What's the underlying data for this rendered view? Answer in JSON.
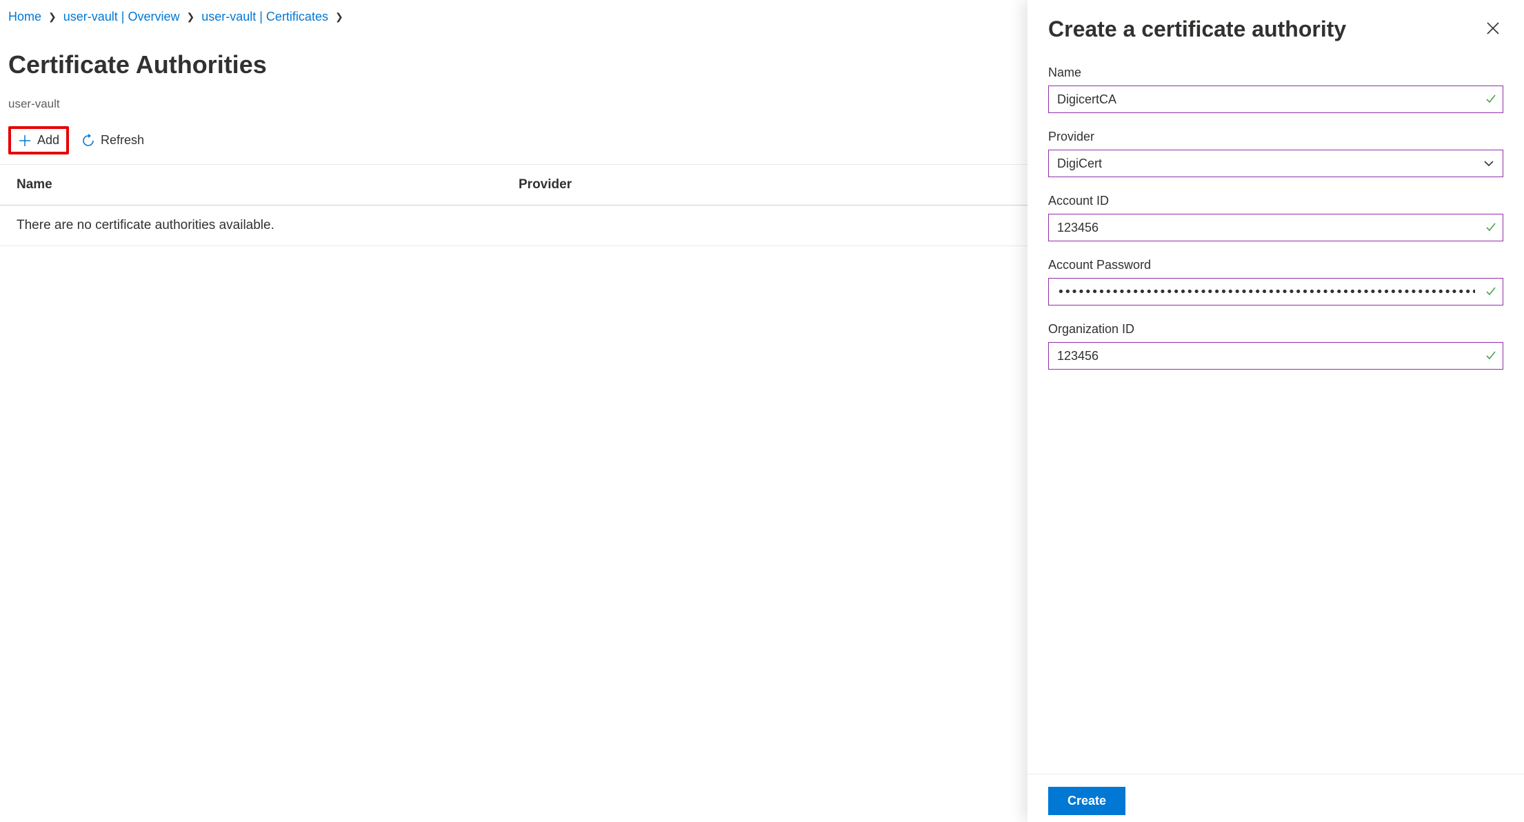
{
  "breadcrumb": {
    "home": "Home",
    "overview": "user-vault | Overview",
    "certs": "user-vault | Certificates"
  },
  "page": {
    "title": "Certificate Authorities",
    "subtitle": "user-vault"
  },
  "toolbar": {
    "add": "Add",
    "refresh": "Refresh"
  },
  "table": {
    "colName": "Name",
    "colProvider": "Provider",
    "empty": "There are no certificate authorities available."
  },
  "flyout": {
    "title": "Create a certificate authority",
    "name_label": "Name",
    "name_value": "DigicertCA",
    "provider_label": "Provider",
    "provider_value": "DigiCert",
    "account_id_label": "Account ID",
    "account_id_value": "123456",
    "account_pw_label": "Account Password",
    "account_pw_value": "••••••••••••••••••••••••••••••••••••••••••••••••••••••••••••••••••••••••••••••••••••••••••••••••••…",
    "org_id_label": "Organization ID",
    "org_id_value": "123456",
    "create": "Create"
  }
}
